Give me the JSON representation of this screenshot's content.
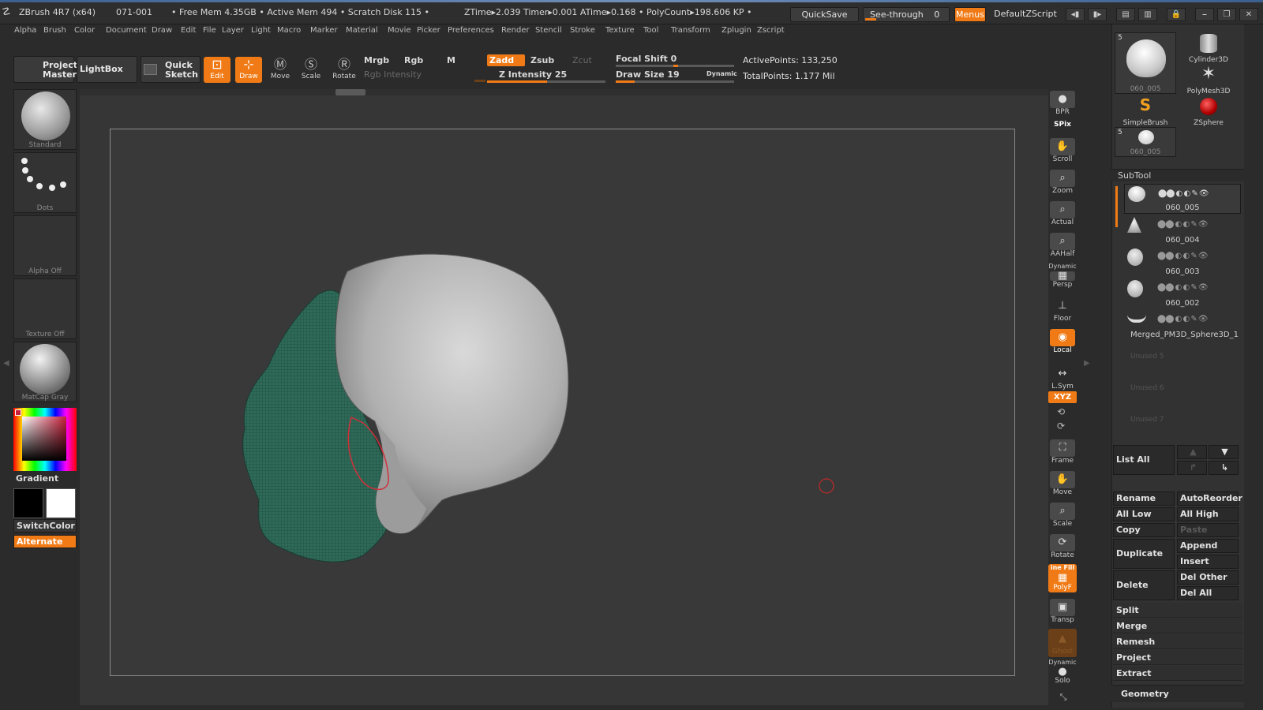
{
  "titlebar": {
    "app": "ZBrush 4R7 (x64)",
    "build": "071-001",
    "stats": "• Free Mem 4.35GB • Active Mem 494 • Scratch Disk 115 •",
    "timers": "ZTime▸2.039  Timer▸0.001  ATime▸0.168 • PolyCount▸198.606 KP •",
    "quicksave": "QuickSave",
    "seethrough_label": "See-through",
    "seethrough_value": "0",
    "menus": "Menus",
    "script": "DefaultZScript"
  },
  "menubar": [
    "Alpha",
    "Brush",
    "Color",
    "Document",
    "Draw",
    "Edit",
    "File",
    "Layer",
    "Light",
    "Macro",
    "Marker",
    "Material",
    "Movie",
    "Picker",
    "Preferences",
    "Render",
    "Stencil",
    "Stroke",
    "Texture",
    "Tool",
    "Transform",
    "Zplugin",
    "Zscript"
  ],
  "shelf": {
    "projection_master_1": "Projection",
    "projection_master_2": "Master",
    "lightbox": "LightBox",
    "quick_sketch_1": "Quick",
    "quick_sketch_2": "Sketch",
    "edit": "Edit",
    "draw": "Draw",
    "move": "Move",
    "scale": "Scale",
    "rotate": "Rotate",
    "mrgb": "Mrgb",
    "rgb": "Rgb",
    "m": "M",
    "rgb_intensity": "Rgb  Intensity",
    "zadd": "Zadd",
    "zsub": "Zsub",
    "zcut": "Zcut",
    "z_intensity": "Z Intensity 25",
    "z_intensity_value": 25,
    "focal_shift": "Focal Shift 0",
    "draw_size": "Draw  Size 19",
    "draw_size_value": 19,
    "dynamic": "Dynamic",
    "active_points": "ActivePoints: 133,250",
    "total_points": "TotalPoints: 1.177  Mil"
  },
  "lefttray": {
    "brush": "Standard",
    "stroke": "Dots",
    "alpha": "Alpha  Off",
    "texture": "Texture  Off",
    "material": "MatCap  Gray",
    "gradient": "Gradient",
    "switchcolor": "SwitchColor",
    "alternate": "Alternate"
  },
  "rightshelf": {
    "bpr": "BPR",
    "spix": "SPix",
    "scroll": "Scroll",
    "zoom": "Zoom",
    "actual": "Actual",
    "aahalf": "AAHalf",
    "dynamic": "Dynamic",
    "persp": "Persp",
    "floor": "Floor",
    "local": "Local",
    "lsym": "L.Sym",
    "xyz": "XYZ",
    "frame": "Frame",
    "move": "Move",
    "scale": "Scale",
    "rotate": "Rotate",
    "linefill": "ine Fill",
    "polyf": "PolyF",
    "transp": "Transp",
    "ghost": "Ghost",
    "dynamic2": "Dynamic",
    "solo": "Solo"
  },
  "toolpanel": {
    "current_count": "5",
    "current_name": "060_005",
    "cylinder": "Cylinder3D",
    "polymesh": "PolyMesh3D",
    "simplebrush": "SimpleBrush",
    "zsphere": "ZSphere",
    "small_count": "5",
    "small_name": "060_005"
  },
  "subtool": {
    "title": "SubTool",
    "items": [
      "060_005",
      "060_004",
      "060_003",
      "060_002",
      "Merged_PM3D_Sphere3D_1"
    ],
    "unused": [
      "Unused  5",
      "Unused  6",
      "Unused  7"
    ],
    "list_all": "List  All",
    "rename": "Rename",
    "autoreorder": "AutoReorder",
    "all_low": "All Low",
    "all_high": "All High",
    "copy": "Copy",
    "paste": "Paste",
    "duplicate": "Duplicate",
    "append": "Append",
    "insert": "Insert",
    "delete": "Delete",
    "del_other": "Del Other",
    "del_all": "Del All",
    "split": "Split",
    "merge": "Merge",
    "remesh": "Remesh",
    "project": "Project",
    "extract": "Extract",
    "geometry": "Geometry"
  },
  "colors": {
    "accent": "#f07b16",
    "mesh_green": "#2f6a58",
    "skull_gray": "#b9b9b9"
  }
}
